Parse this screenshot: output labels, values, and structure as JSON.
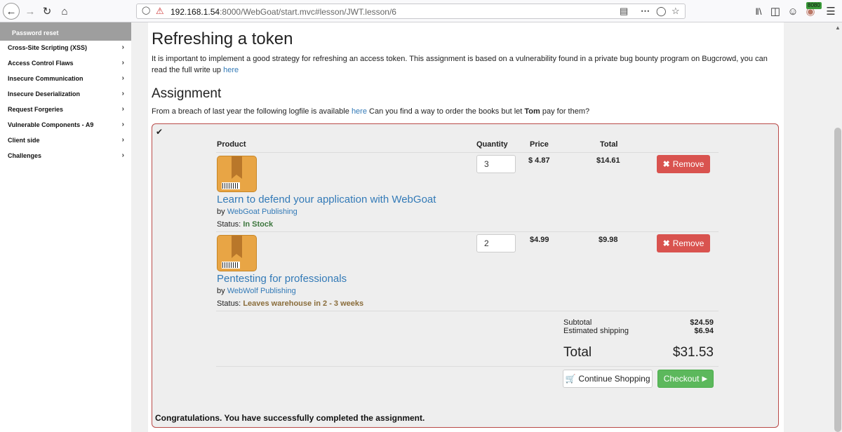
{
  "browser": {
    "url_host": "192.168.1.54",
    "url_path": ":8000/WebGoat/start.mvc#lesson/JWT.lesson/6",
    "badge": "8080"
  },
  "sidebar": {
    "active_item": "Password reset",
    "items": [
      {
        "label": "Cross-Site Scripting (XSS)"
      },
      {
        "label": "Access Control Flaws"
      },
      {
        "label": "Insecure Communication"
      },
      {
        "label": "Insecure Deserialization"
      },
      {
        "label": "Request Forgeries"
      },
      {
        "label": "Vulnerable Components - A9"
      },
      {
        "label": "Client side"
      },
      {
        "label": "Challenges"
      }
    ]
  },
  "lesson": {
    "title": "Refreshing a token",
    "intro_1": "It is important to implement a good strategy for refreshing an access token. This assignment is based on a vulnerability found in a private bug bounty program on Bugcrowd, you can read the full write up",
    "intro_link": "here",
    "assignment_title": "Assignment",
    "assignment_pre": "From a breach of last year the following logfile is available",
    "assignment_link": "here",
    "assignment_mid": "Can you find a way to order the books but let",
    "assignment_bold": "Tom",
    "assignment_post": "pay for them?"
  },
  "cart": {
    "headers": {
      "product": "Product",
      "quantity": "Quantity",
      "price": "Price",
      "total": "Total"
    },
    "remove_label": "Remove",
    "by_label": "by",
    "status_label": "Status:",
    "items": [
      {
        "title": "Learn to defend your application with WebGoat",
        "publisher": "WebGoat Publishing",
        "status": "In Stock",
        "quantity": "3",
        "price": "$ 4.87",
        "total": "$14.61"
      },
      {
        "title": "Pentesting for professionals",
        "publisher": "WebWolf Publishing",
        "status": "Leaves warehouse in 2 - 3 weeks",
        "quantity": "2",
        "price": "$4.99",
        "total": "$9.98"
      }
    ],
    "subtotal_label": "Subtotal",
    "subtotal": "$24.59",
    "shipping_label": "Estimated shipping",
    "shipping": "$6.94",
    "grand_total_label": "Total",
    "grand_total": "$31.53",
    "continue_label": "Continue Shopping",
    "checkout_label": "Checkout",
    "congrats": "Congratulations. You have successfully completed the assignment."
  },
  "colors": {
    "remove_btn": "#d9534f",
    "checkout_btn": "#5cb85c",
    "link": "#337ab7",
    "in_stock": "#3c763d",
    "warehouse": "#8a6d3b",
    "box_border": "#b94a48"
  }
}
